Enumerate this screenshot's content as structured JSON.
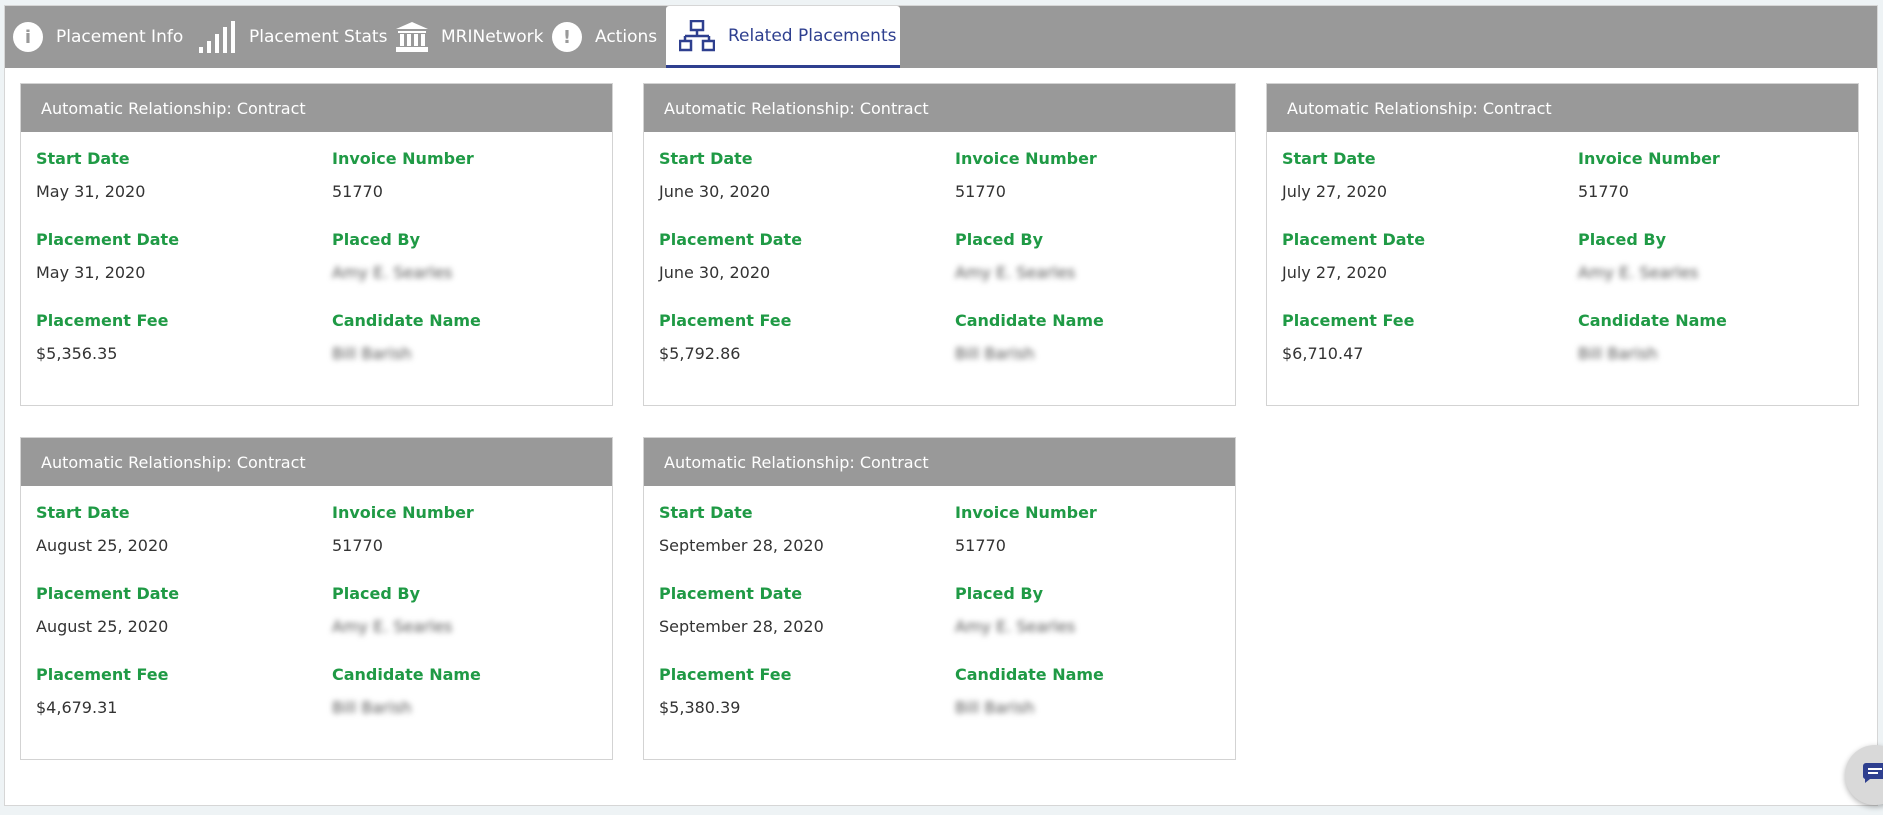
{
  "tabs": [
    {
      "label": "Placement Info",
      "icon": "info-icon"
    },
    {
      "label": "Placement Stats",
      "icon": "signal-bars-icon"
    },
    {
      "label": "MRINetwork",
      "icon": "bank-icon"
    },
    {
      "label": "Actions",
      "icon": "exclamation-icon"
    },
    {
      "label": "Related Placements",
      "icon": "network-icon",
      "active": true
    }
  ],
  "field_labels": {
    "start_date": "Start Date",
    "invoice_number": "Invoice Number",
    "placement_date": "Placement Date",
    "placed_by": "Placed By",
    "placement_fee": "Placement Fee",
    "candidate_name": "Candidate Name"
  },
  "cards": [
    {
      "title": "Automatic Relationship: Contract",
      "start_date": "May 31, 2020",
      "invoice_number": "51770",
      "placement_date": "May 31, 2020",
      "placed_by": "Amy E. Searles",
      "placement_fee": "$5,356.35",
      "candidate_name": "Bill Barish"
    },
    {
      "title": "Automatic Relationship: Contract",
      "start_date": "June 30, 2020",
      "invoice_number": "51770",
      "placement_date": "June 30, 2020",
      "placed_by": "Amy E. Searles",
      "placement_fee": "$5,792.86",
      "candidate_name": "Bill Barish"
    },
    {
      "title": "Automatic Relationship: Contract",
      "start_date": "July 27, 2020",
      "invoice_number": "51770",
      "placement_date": "July 27, 2020",
      "placed_by": "Amy E. Searles",
      "placement_fee": "$6,710.47",
      "candidate_name": "Bill Barish"
    },
    {
      "title": "Automatic Relationship: Contract",
      "start_date": "August 25, 2020",
      "invoice_number": "51770",
      "placement_date": "August 25, 2020",
      "placed_by": "Amy E. Searles",
      "placement_fee": "$4,679.31",
      "candidate_name": "Bill Barish"
    },
    {
      "title": "Automatic Relationship: Contract",
      "start_date": "September 28, 2020",
      "invoice_number": "51770",
      "placement_date": "September 28, 2020",
      "placed_by": "Amy E. Searles",
      "placement_fee": "$5,380.39",
      "candidate_name": "Bill Barish"
    }
  ],
  "colors": {
    "header_gray": "#999999",
    "label_green": "#1f9a45",
    "active_tab": "#2e3f8f"
  },
  "chat": {
    "icon": "chat-icon"
  }
}
